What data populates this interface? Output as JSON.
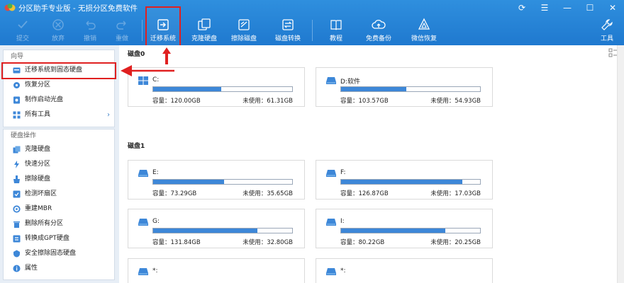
{
  "window": {
    "title": "分区助手专业版 - 无损分区免费软件",
    "controls": [
      "⟳",
      "☰",
      "—",
      "☐",
      "✕"
    ]
  },
  "toolbar": {
    "items": [
      {
        "label": "提交",
        "icon": "check-icon",
        "enabled": false
      },
      {
        "label": "放弃",
        "icon": "cancel-icon",
        "enabled": false
      },
      {
        "label": "撤销",
        "icon": "undo-icon",
        "enabled": false
      },
      {
        "label": "重做",
        "icon": "redo-icon",
        "enabled": false
      },
      {
        "label": "迁移系统",
        "icon": "migrate-os-icon",
        "enabled": true
      },
      {
        "label": "克隆硬盘",
        "icon": "clone-disk-icon",
        "enabled": true
      },
      {
        "label": "擦除磁盘",
        "icon": "wipe-disk-icon",
        "enabled": true
      },
      {
        "label": "磁盘转换",
        "icon": "disk-convert-icon",
        "enabled": true
      },
      {
        "label": "教程",
        "icon": "tutorial-icon",
        "enabled": true
      },
      {
        "label": "免费备份",
        "icon": "free-backup-icon",
        "enabled": true
      },
      {
        "label": "微信恢复",
        "icon": "wechat-recovery-icon",
        "enabled": true
      },
      {
        "label": "工具",
        "icon": "tools-icon",
        "enabled": true
      }
    ]
  },
  "sidebar": {
    "wizard": {
      "title": "向导",
      "items": [
        {
          "label": "迁移系统到固态硬盘",
          "icon": "migrate-icon"
        },
        {
          "label": "恢复分区",
          "icon": "recover-icon"
        },
        {
          "label": "制作启动光盘",
          "icon": "boot-disc-icon"
        },
        {
          "label": "所有工具",
          "icon": "all-tools-icon",
          "arrow": "›"
        }
      ]
    },
    "disk_ops": {
      "title": "硬盘操作",
      "items": [
        {
          "label": "克隆硬盘",
          "icon": "clone-icon"
        },
        {
          "label": "快速分区",
          "icon": "quick-partition-icon"
        },
        {
          "label": "擦除硬盘",
          "icon": "wipe-icon"
        },
        {
          "label": "检测坏扇区",
          "icon": "bad-sector-icon"
        },
        {
          "label": "重建MBR",
          "icon": "rebuild-mbr-icon"
        },
        {
          "label": "删除所有分区",
          "icon": "delete-all-icon"
        },
        {
          "label": "转换成GPT硬盘",
          "icon": "convert-gpt-icon"
        },
        {
          "label": "安全擦除固态硬盘",
          "icon": "secure-erase-icon"
        },
        {
          "label": "属性",
          "icon": "properties-icon"
        }
      ]
    }
  },
  "main": {
    "disks": [
      {
        "title": "磁盘0",
        "partitions": [
          {
            "name": "C:",
            "capacity": "容量：120.00GB",
            "free": "未使用：61.31GB",
            "used_fraction": 0.49,
            "icon": "windows-drive-icon"
          },
          {
            "name": "D:软件",
            "capacity": "容量：103.57GB",
            "free": "未使用：54.93GB",
            "used_fraction": 0.47,
            "icon": "drive-icon"
          }
        ]
      },
      {
        "title": "磁盘1",
        "partitions": [
          {
            "name": "E:",
            "capacity": "容量：73.29GB",
            "free": "未使用：35.65GB",
            "used_fraction": 0.51,
            "icon": "drive-icon"
          },
          {
            "name": "F:",
            "capacity": "容量：126.87GB",
            "free": "未使用：17.03GB",
            "used_fraction": 0.87,
            "icon": "drive-icon"
          },
          {
            "name": "G:",
            "capacity": "容量：131.84GB",
            "free": "未使用：32.80GB",
            "used_fraction": 0.75,
            "icon": "drive-icon"
          },
          {
            "name": "I:",
            "capacity": "容量：80.22GB",
            "free": "未使用：20.25GB",
            "used_fraction": 0.75,
            "icon": "drive-icon"
          },
          {
            "name": "*:",
            "capacity": "",
            "free": "",
            "used_fraction": 0,
            "icon": "drive-icon"
          },
          {
            "name": "*:",
            "capacity": "",
            "free": "",
            "used_fraction": 0,
            "icon": "drive-icon"
          }
        ]
      }
    ]
  },
  "colors": {
    "titlebar": "#2386d6",
    "accent": "#3d87d8",
    "highlight": "#e02020"
  }
}
